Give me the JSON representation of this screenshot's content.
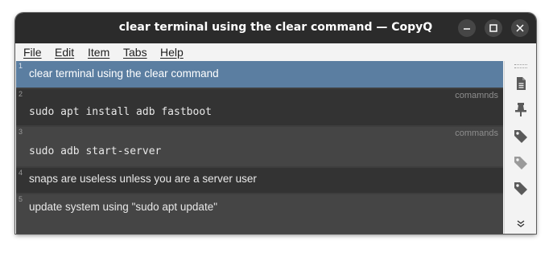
{
  "window": {
    "title": "clear terminal using the clear command — CopyQ"
  },
  "menu": [
    {
      "label": "File"
    },
    {
      "label": "Edit"
    },
    {
      "label": "Item"
    },
    {
      "label": "Tabs"
    },
    {
      "label": "Help"
    }
  ],
  "items": [
    {
      "num": "1",
      "text": "clear terminal using the clear command",
      "tag": "",
      "selected": true
    },
    {
      "num": "2",
      "text": "sudo apt install adb fastboot",
      "tag": "comamnds",
      "selected": false
    },
    {
      "num": "3",
      "text": "sudo adb start-server",
      "tag": "commands",
      "selected": false
    },
    {
      "num": "4",
      "text": "snaps are useless unless you are a server user",
      "tag": "",
      "selected": false
    },
    {
      "num": "5",
      "text": "update system using \"sudo apt update\"",
      "tag": "",
      "selected": false
    }
  ],
  "toolbar_icons": [
    "document-icon",
    "pin-icon",
    "tag-icon",
    "tag-icon",
    "tag-icon",
    "chevron-down-icon"
  ],
  "colors": {
    "selection": "#5b7ea1",
    "titlebar": "#2b2b2b",
    "list_background": "#3e3e3e"
  }
}
